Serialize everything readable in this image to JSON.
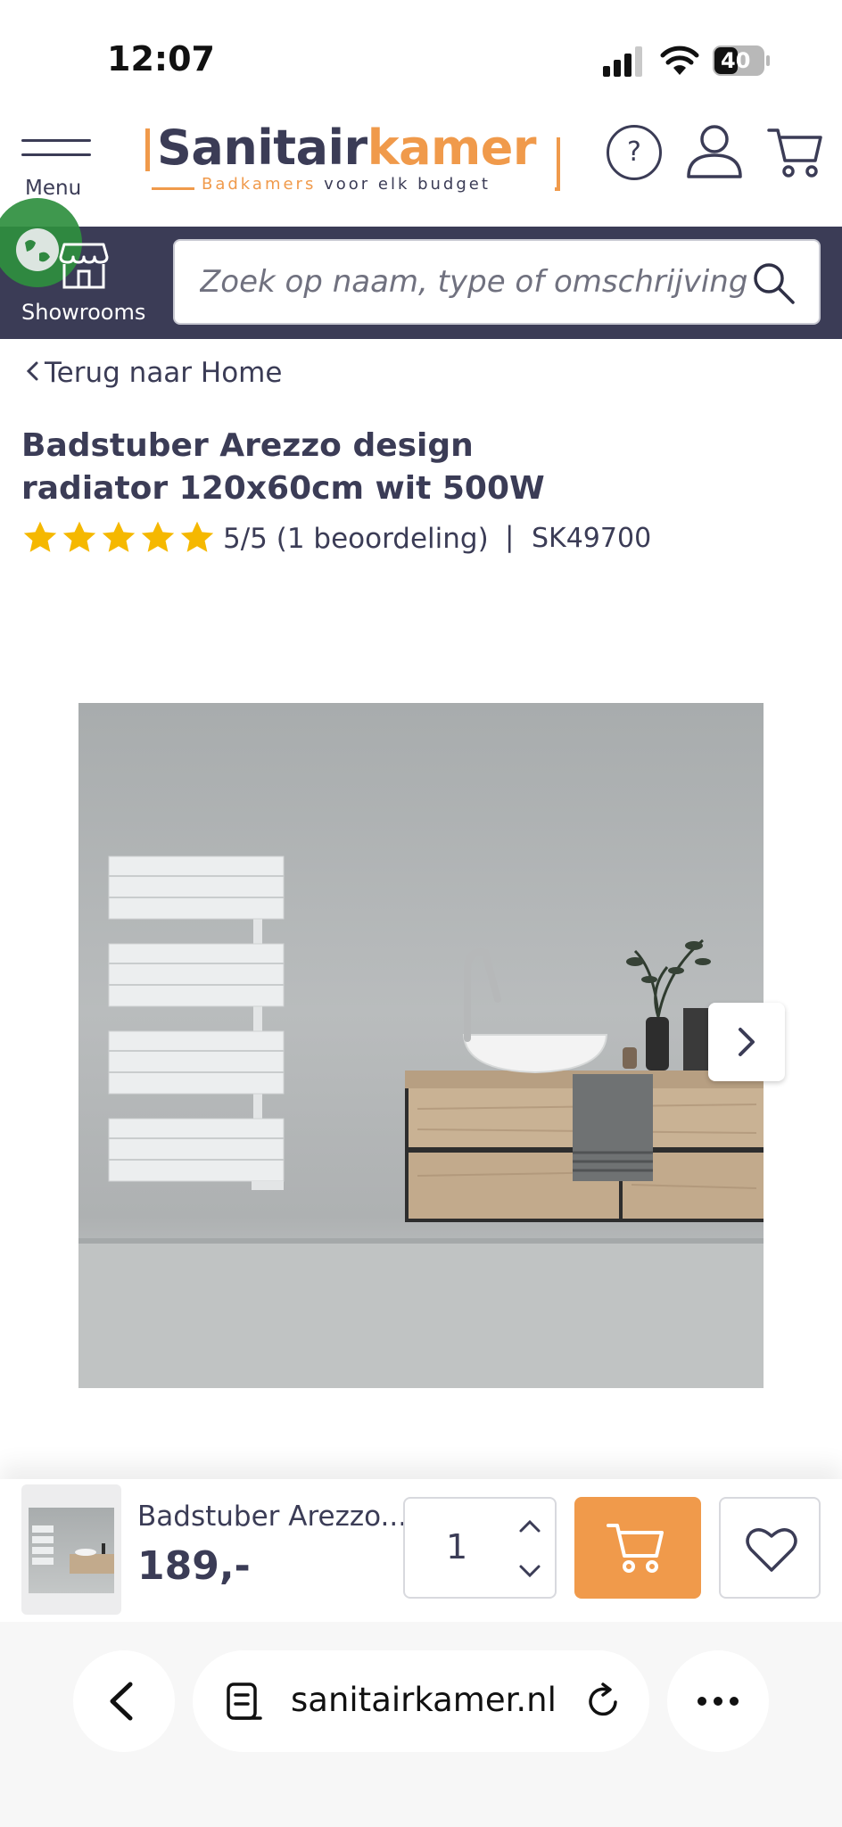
{
  "status_bar": {
    "time": "12:07",
    "battery": "40"
  },
  "header": {
    "menu_label": "Menu",
    "logo": {
      "part1": "Sanitair",
      "part2": "kamer",
      "tagline_orange": "Badkamers",
      "tagline_rest": " voor elk budget"
    },
    "help_label": "?"
  },
  "navbar": {
    "showrooms_label": "Showrooms",
    "search_placeholder": "Zoek op naam, type of omschrijving"
  },
  "breadcrumb": {
    "back_label": "Terug naar Home"
  },
  "product": {
    "title": "Badstuber Arezzo design radiator 120x60cm wit 500W",
    "rating": 5,
    "rating_max": 5,
    "rating_text": "5/5 (1 beoordeling)",
    "separator": "|",
    "sku": "SK49700",
    "image_count_visible": 1
  },
  "sticky_bar": {
    "name": "Badstuber Arezzo...",
    "price": "189,-",
    "quantity": "1"
  },
  "browser": {
    "url": "sanitairkamer.nl"
  },
  "colors": {
    "brand_dark": "#3b3c56",
    "brand_orange": "#f09a4b",
    "star": "#f5b800"
  }
}
